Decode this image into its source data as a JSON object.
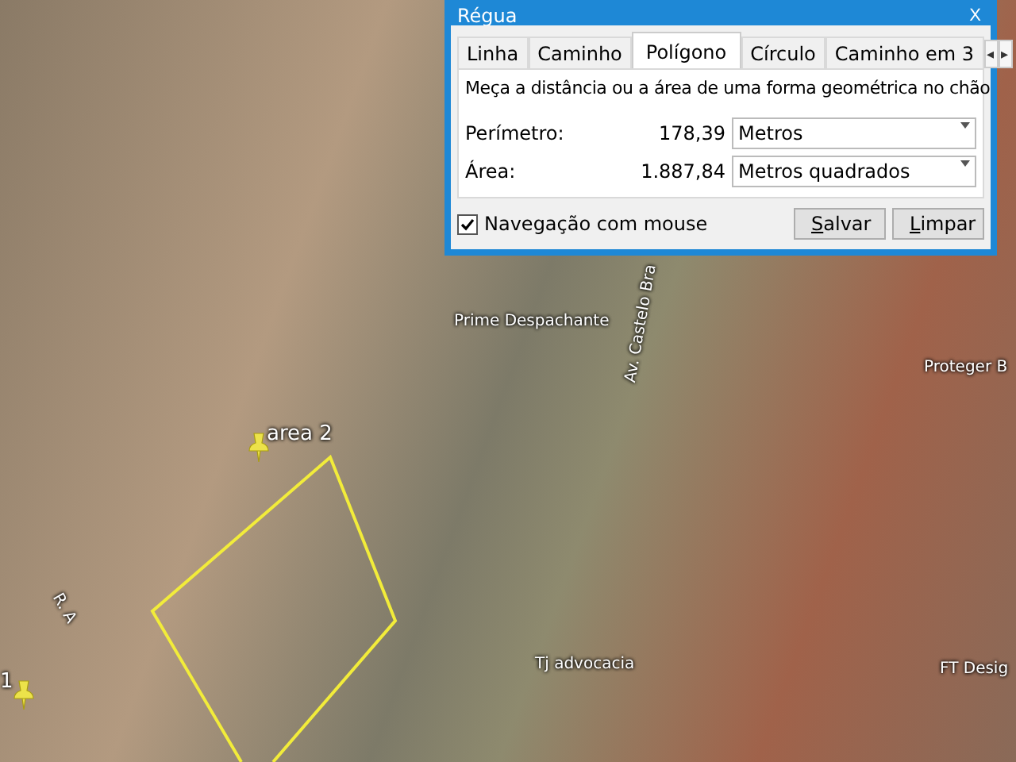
{
  "map": {
    "labels": [
      {
        "text": "area 2",
        "kind": "pin"
      },
      {
        "text": "1",
        "kind": "pin"
      },
      {
        "text": "Prime Despachante",
        "kind": "place"
      },
      {
        "text": "Proteger B",
        "kind": "place"
      },
      {
        "text": "Tj advocacia",
        "kind": "place"
      },
      {
        "text": "FT Desig",
        "kind": "place"
      },
      {
        "text": "Av. Castelo Bra",
        "kind": "road"
      },
      {
        "text": "R. A",
        "kind": "road"
      }
    ]
  },
  "dialog": {
    "title": "Régua",
    "close": "X",
    "tabs": [
      {
        "label": "Linha",
        "selected": false
      },
      {
        "label": "Caminho",
        "selected": false
      },
      {
        "label": "Polígono",
        "selected": true
      },
      {
        "label": "Círculo",
        "selected": false
      },
      {
        "label": "Caminho em 3",
        "selected": false
      }
    ],
    "tab_scroll": [
      "◂",
      "▸"
    ],
    "description": "Meça a distância ou a área de uma forma geométrica no chão",
    "measurements": [
      {
        "label": "Perímetro:",
        "value": "178,39",
        "unit": "Metros"
      },
      {
        "label": "Área:",
        "value": "1.887,84",
        "unit": "Metros quadrados"
      }
    ],
    "mouse_navigation": {
      "label": "Navegação com mouse",
      "checked": true
    },
    "buttons": [
      "Salvar",
      "Limpar"
    ]
  }
}
